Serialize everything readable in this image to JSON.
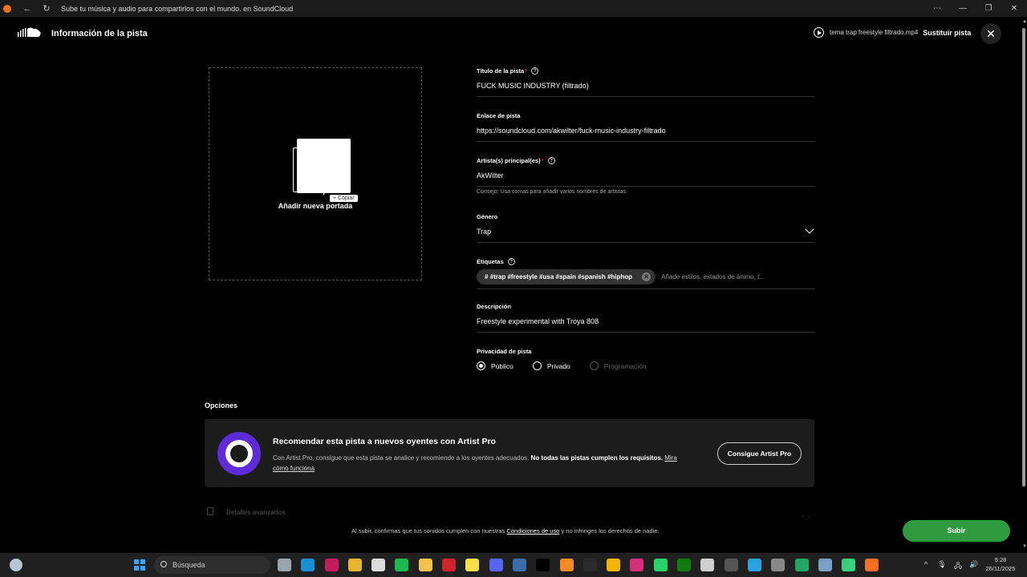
{
  "browser": {
    "title": "Sube tu música y audio para compartirlos con el mundo. en SoundCloud",
    "back": "←",
    "reload": "↻",
    "menu": "⋯",
    "minimize": "—",
    "restore": "❐",
    "close": "✕"
  },
  "header": {
    "title": "Información de la pista",
    "filename": "tema trap freestyle filtrado.mp4",
    "replace_label": "Sustituir pista",
    "close": "✕"
  },
  "cover": {
    "label": "Añadir nueva portada",
    "tooltip": "+ Copiar"
  },
  "form": {
    "title_label": "Título de la pista",
    "required_mark": "*",
    "help": "?",
    "title_value": "FUCK MUSIC INDUSTRY (filtrado)",
    "link_label": "Enlace de pista",
    "link_value": "https://soundcloud.com/akwilter/fuck-music-industry-filtrado",
    "artist_label": "Artista(s) principal(es)",
    "artist_value": "AkWilter",
    "artist_hint": "Consejo: Usa comas para añadir varios nombres de artistas.",
    "genre_label": "Género",
    "genre_value": "Trap",
    "tags_label": "Etiquetas",
    "tag_chip": "# #trap #freestyle #usa #spain #spanish #hiphop",
    "tag_remove": "✕",
    "tags_placeholder": "Añade estilos, estados de ánimo, t...",
    "description_label": "Descripción",
    "description_value": "Freestyle experimental with Troya 808",
    "privacy_label": "Privacidad de pista",
    "privacy_options": [
      "Público",
      "Privado",
      "Programación"
    ],
    "privacy_selected": "Público"
  },
  "options": {
    "heading": "Opciones",
    "promo_title": "Recomendar esta pista a nuevos oyentes con Artist Pro",
    "promo_text": "Con Artist Pro, consigue que esta pista se analice y recomiende a los oyentes adecuados.",
    "promo_bold": "No todas las pistas cumplen los requisitos.",
    "promo_link": "Mira cómo funciona",
    "promo_button": "Consigue Artist Pro",
    "next_section": "Detalles avanzados"
  },
  "footer": {
    "legal_prefix": "Al subir, confirmas que tus sonidos cumplen con nuestras",
    "legal_link": "Condiciones de uso",
    "legal_suffix": "y no infringes los derechos de nadie.",
    "upload": "Subir"
  },
  "taskbar": {
    "search": "Búsqueda",
    "time": "5:28",
    "date": "26/11/2025",
    "tray_up": "^",
    "tray_mic": "🎙",
    "tray_net": "🖧",
    "tray_vol": "🔊",
    "apps": [
      {
        "name": "task-view-icon",
        "color": "#9aa4ad"
      },
      {
        "name": "edge-icon",
        "color": "#1b8fd6"
      },
      {
        "name": "opera-icon",
        "color": "#c21d5c"
      },
      {
        "name": "chrome-icon",
        "color": "#e8b52e"
      },
      {
        "name": "store-icon",
        "color": "#dcdcdc"
      },
      {
        "name": "spotify-icon",
        "color": "#1db954"
      },
      {
        "name": "explorer-icon",
        "color": "#f2c24c"
      },
      {
        "name": "app-red-icon",
        "color": "#d0242b"
      },
      {
        "name": "notes-icon",
        "color": "#f7e14a"
      },
      {
        "name": "discord-icon",
        "color": "#5865f2"
      },
      {
        "name": "steam-icon",
        "color": "#3b6ea8"
      },
      {
        "name": "netflix-icon",
        "color": "#000000"
      },
      {
        "name": "fl-studio-icon",
        "color": "#f08a24"
      },
      {
        "name": "epic-games-icon",
        "color": "#2a2a2a"
      },
      {
        "name": "rockstar-icon",
        "color": "#f5b400"
      },
      {
        "name": "instagram-icon",
        "color": "#d6307a"
      },
      {
        "name": "whatsapp-icon",
        "color": "#25d366"
      },
      {
        "name": "xbox-icon",
        "color": "#107c10"
      },
      {
        "name": "app-stack-icon",
        "color": "#cfcfcf"
      },
      {
        "name": "app-notify-icon",
        "color": "#555555"
      },
      {
        "name": "telegram-icon",
        "color": "#2aa3de"
      },
      {
        "name": "app-grid-icon",
        "color": "#888888"
      },
      {
        "name": "sheets-icon",
        "color": "#22a565"
      },
      {
        "name": "camera-icon",
        "color": "#7aa0c8"
      },
      {
        "name": "app-green-icon",
        "color": "#3ccf7d"
      },
      {
        "name": "soundcloud-icon",
        "color": "#f26f23"
      }
    ]
  }
}
